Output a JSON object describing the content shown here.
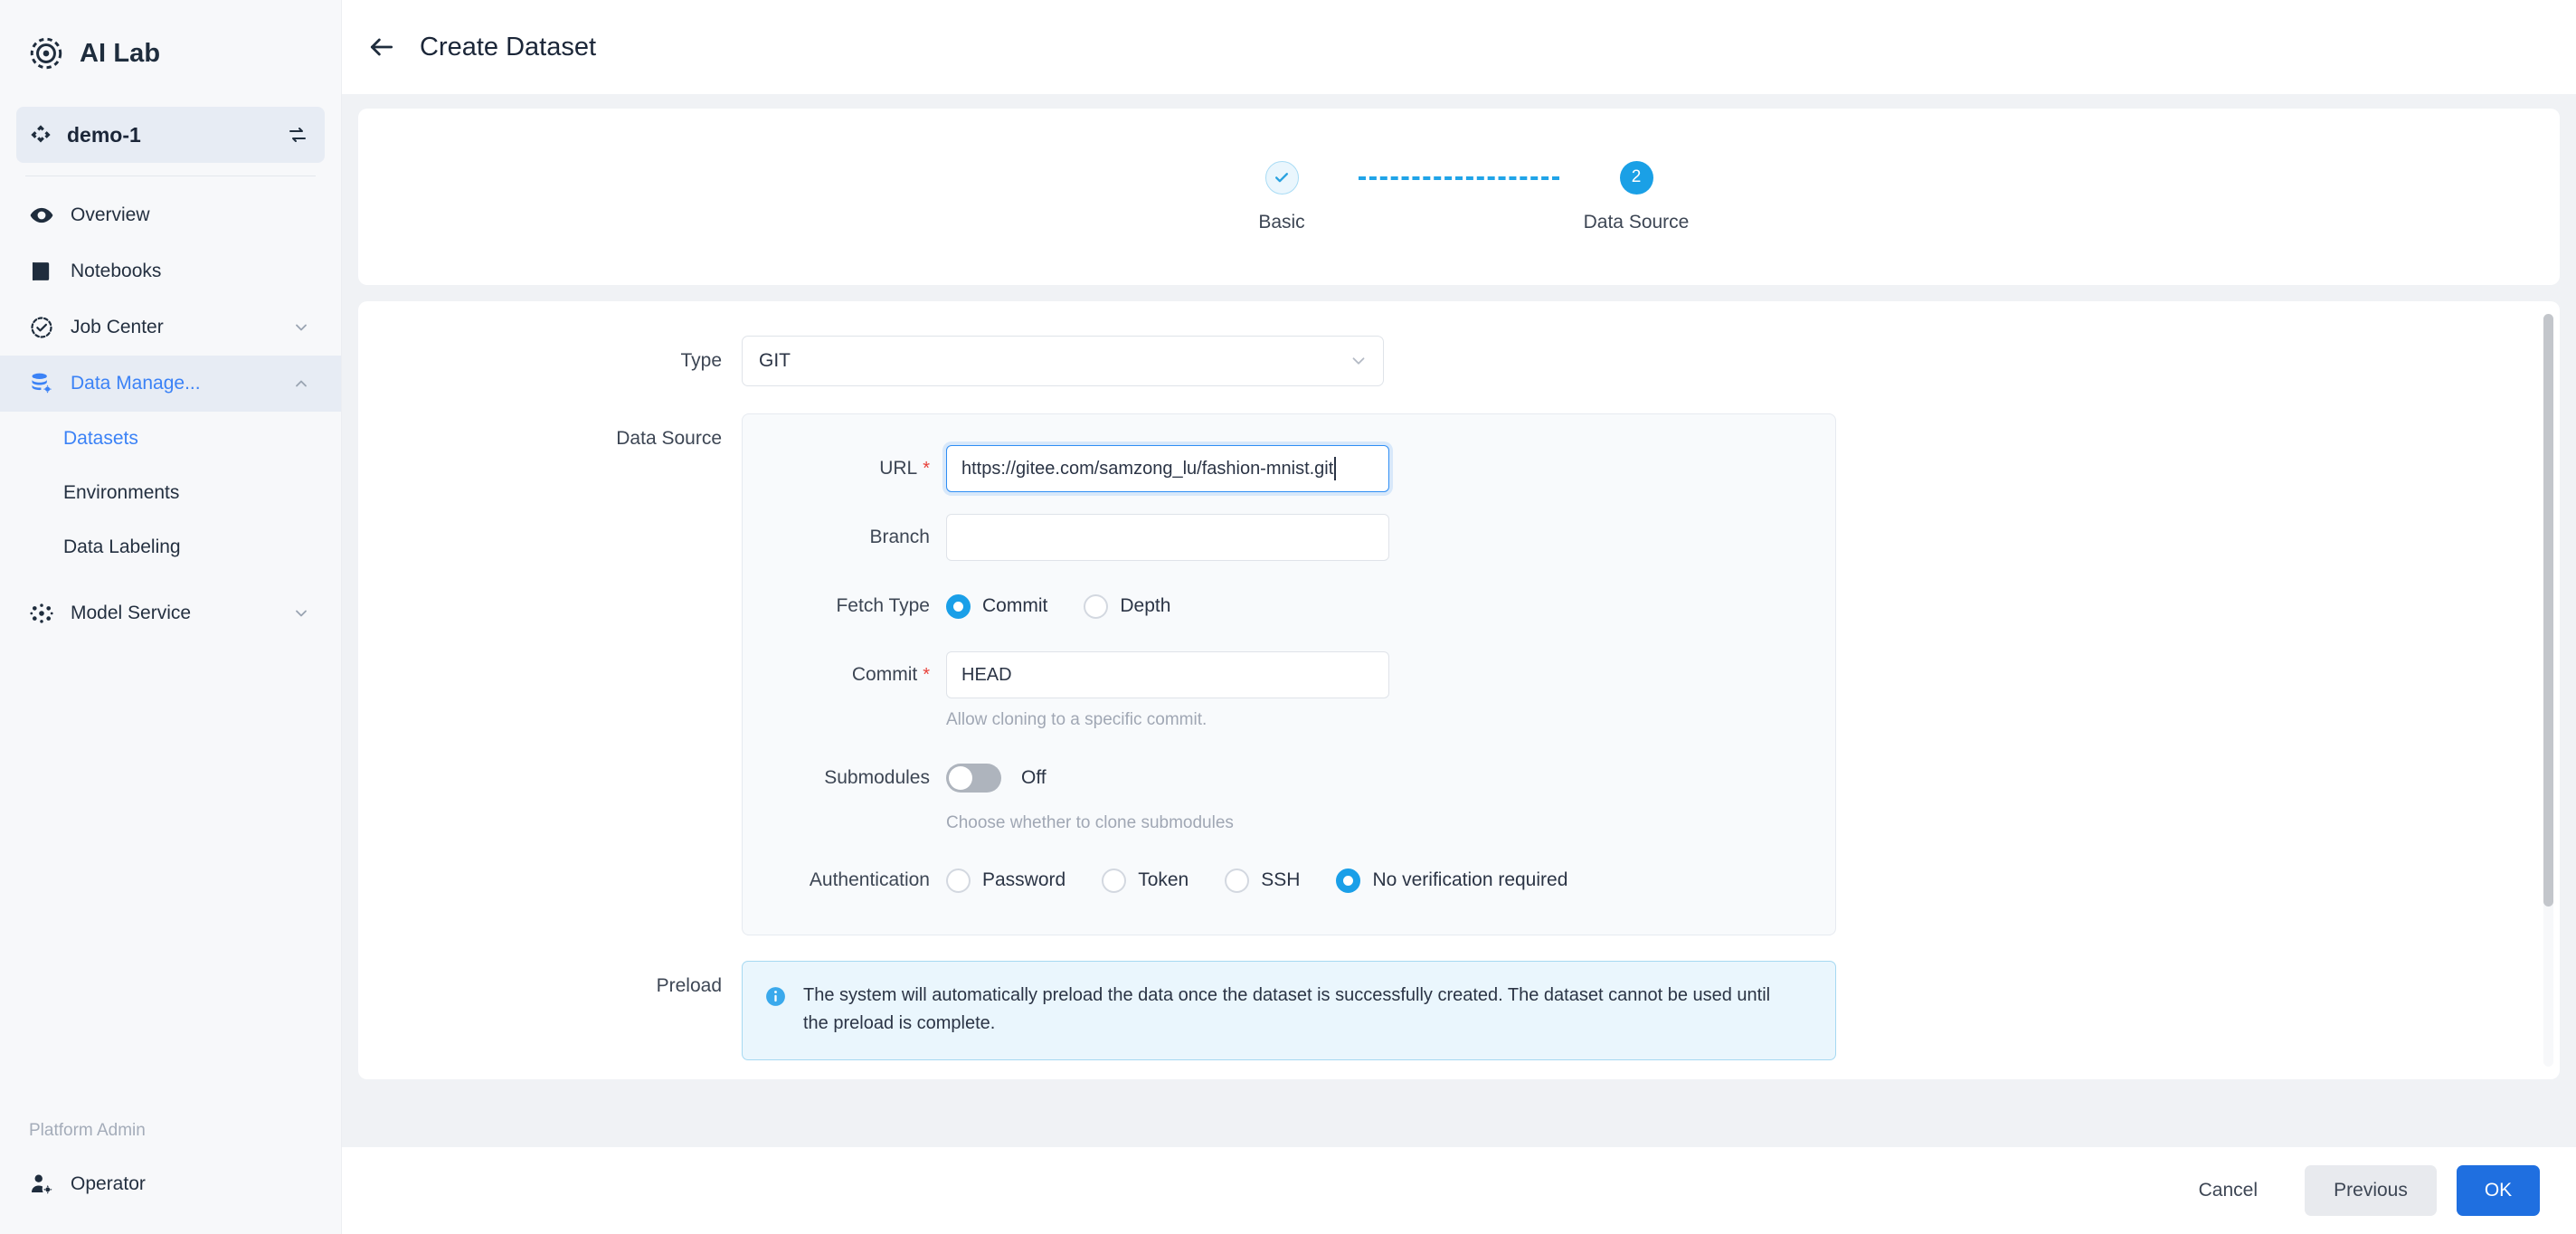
{
  "sidebar": {
    "brand": {
      "name": "AI Lab",
      "logo_icon": "atom-target-icon"
    },
    "workspace": {
      "name": "demo-1",
      "icon": "workspace-diamond-icon",
      "switch_icon": "switch-arrows-icon"
    },
    "items": [
      {
        "label": "Overview",
        "icon": "eye-icon",
        "has_chevron": false
      },
      {
        "label": "Notebooks",
        "icon": "book-icon",
        "has_chevron": false
      },
      {
        "label": "Job Center",
        "icon": "check-circle-dashed-icon",
        "has_chevron": true
      },
      {
        "label": "Data Manage...",
        "icon": "database-gear-icon",
        "has_chevron": true
      }
    ],
    "sub_items": [
      {
        "label": "Datasets",
        "active": true
      },
      {
        "label": "Environments",
        "active": false
      },
      {
        "label": "Data Labeling",
        "active": false
      }
    ],
    "model_service": {
      "label": "Model Service",
      "icon": "nodes-icon",
      "has_chevron": true
    },
    "footer_section_label": "Platform Admin",
    "footer_item": {
      "label": "Operator",
      "icon": "user-gear-icon"
    }
  },
  "topbar": {
    "back_icon": "arrow-left-icon",
    "title": "Create Dataset"
  },
  "stepper": {
    "steps": [
      {
        "label": "Basic",
        "state": "done",
        "marker": "check-icon"
      },
      {
        "label": "Data Source",
        "state": "current",
        "marker": "2"
      }
    ]
  },
  "form": {
    "type": {
      "label": "Type",
      "value": "GIT",
      "chevron_icon": "chevron-down-icon"
    },
    "data_source_label": "Data Source",
    "url": {
      "label": "URL",
      "required": true,
      "value": "https://gitee.com/samzong_lu/fashion-mnist.git",
      "placeholder": ""
    },
    "branch": {
      "label": "Branch",
      "required": false,
      "value": "",
      "placeholder": ""
    },
    "fetch_type": {
      "label": "Fetch Type",
      "options": [
        {
          "label": "Commit",
          "selected": true
        },
        {
          "label": "Depth",
          "selected": false
        }
      ]
    },
    "commit": {
      "label": "Commit",
      "required": true,
      "value": "HEAD",
      "hint": "Allow cloning to a specific commit."
    },
    "submodules": {
      "label": "Submodules",
      "state_text": "Off",
      "on": false,
      "hint": "Choose whether to clone submodules"
    },
    "authentication": {
      "label": "Authentication",
      "options": [
        {
          "label": "Password",
          "selected": false
        },
        {
          "label": "Token",
          "selected": false
        },
        {
          "label": "SSH",
          "selected": false
        },
        {
          "label": "No verification required",
          "selected": true
        }
      ]
    },
    "preload": {
      "label": "Preload",
      "icon": "info-circle-icon",
      "message": "The system will automatically preload the data once the dataset is successfully created. The dataset cannot be used until the preload is complete."
    }
  },
  "footer": {
    "cancel_label": "Cancel",
    "previous_label": "Previous",
    "ok_label": "OK"
  },
  "colors": {
    "accent_blue": "#1f6fe0",
    "step_blue": "#1aa0e6",
    "required_red": "#e8413a",
    "sidebar_bg": "#f7f8fa",
    "content_bg": "#f0f2f5"
  }
}
